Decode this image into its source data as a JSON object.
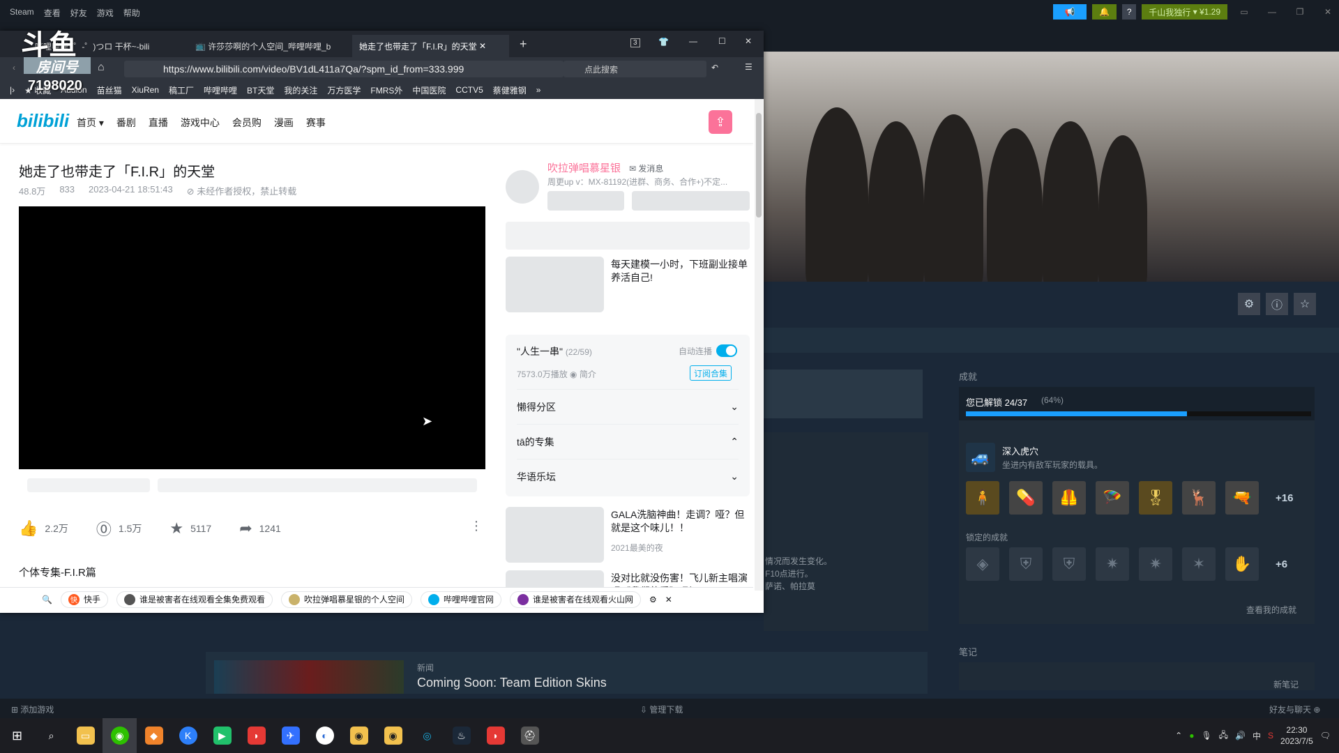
{
  "steam": {
    "app_name": "Steam",
    "menu": [
      "查看",
      "好友",
      "游戏",
      "帮助"
    ],
    "account": "千山我独行",
    "wallet": "¥1.29",
    "help": "?",
    "add_game": "添加游戏",
    "manage_downloads": "管理下载",
    "friends_chat": "好友与聊天"
  },
  "overlay": {
    "logo": "斗鱼",
    "room_label": "房间号",
    "room_number": "7198020"
  },
  "browser": {
    "tabs": [
      "哔哩哔哩 (゜-゜)つロ 干杯~-bili",
      "许莎莎啊的个人空间_哔哩哔哩_b",
      "她走了也带走了「F.I.R」的天堂"
    ],
    "tab_count": "3",
    "url": "https://www.bilibili.com/video/BV1dL411a7Qa/?spm_id_from=333.999",
    "search_placeholder": "点此搜索",
    "bookmarks": [
      "收藏",
      "Audion",
      "苗丝猫",
      "XiuRen",
      "稿工厂",
      "哔哩哔哩",
      "BT天堂",
      "我的关注",
      "万方医学",
      "FMRS外",
      "中国医院",
      "CCTV5",
      "蔡健雅钢"
    ]
  },
  "bili": {
    "logo": "bilibili",
    "nav": [
      "首页 ▾",
      "番剧",
      "直播",
      "游戏中心",
      "会员购",
      "漫画",
      "赛事"
    ],
    "video_title": "她走了也带走了「F.I.R」的天堂",
    "views": "48.8万",
    "danmaku": "833",
    "date": "2023-04-21 18:51:43",
    "copyright": "⊘ 未经作者授权，禁止转载",
    "likes": "2.2万",
    "coins": "1.5万",
    "favorites": "5117",
    "shares": "1241",
    "collection_label": "个体专集-F.I.R篇",
    "up_name": "吹拉弹唱慕星银",
    "send_msg": "✉ 发消息",
    "up_desc": "周更up v：MX-81192(进群、商务、合作+)不定...",
    "rec1_title": "每天建模一小时，下班副业接单养活自己!",
    "playlist_title": "\"人生一串\"",
    "playlist_count": "(22/59)",
    "autoplay": "自动连播",
    "playlist_stats": "7573.0万播放 ◉ 简介",
    "subscribe": "订阅合集",
    "sections": [
      "懒得分区",
      "tā的专集",
      "华语乐坛"
    ],
    "rec2_title": "GALA洗脑神曲！走调？哑？但就是这个味儿！！",
    "rec2_sub": "2021最美的夜",
    "rec3_title": "没对比就没伤害！飞儿新主唱演唱《我们的爱》 刚"
  },
  "bottom_chips": [
    "快手",
    "谁是被害者在线观看全集免费观看",
    "吹拉弹唱慕星银的个人空间",
    "哔哩哔哩官网",
    "谁是被害者在线观看火山网"
  ],
  "game": {
    "achievements_title": "成就",
    "unlocked": "您已解锁 24/37",
    "unlocked_pct": "(64%)",
    "progress": 0.64,
    "recent_name": "深入虎穴",
    "recent_desc": "坐进内有敌军玩家的载具。",
    "more_unlocked": "+16",
    "locked_title": "锁定的成就",
    "more_locked": "+6",
    "view_all": "查看我的成就",
    "notes_title": "笔记",
    "new_note": "新笔记",
    "patch_text": "情况而发生变化。\nF10点进行。\n萨诺、帕拉莫",
    "news_tag": "新闻",
    "news_title": "Coming Soon: Team Edition Skins"
  },
  "clock": {
    "time": "22:30",
    "date": "2023/7/5"
  },
  "tray_ime": "中",
  "colors": {
    "bili_pink": "#fb7299",
    "bili_blue": "#00aeec",
    "steam_bg": "#1b2838",
    "progress": "#1a9fff"
  }
}
